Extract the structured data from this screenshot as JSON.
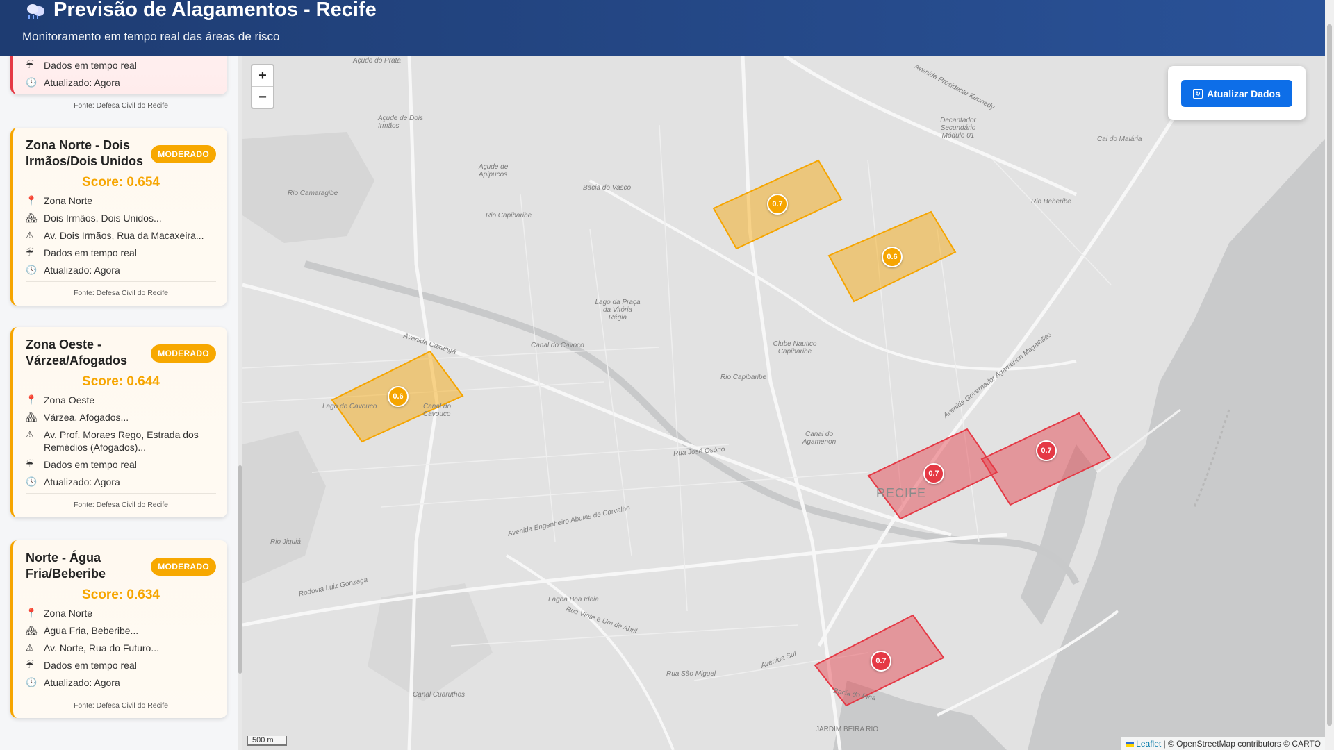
{
  "header": {
    "title": "Previsão de Alagamentos - Recife",
    "subtitle": "Monitoramento em tempo real das áreas de risco"
  },
  "sidebar": {
    "partial_card": {
      "rows": [
        "Dados em tempo real",
        "Atualizado: Agora"
      ],
      "source": "Fonte: Defesa Civil do Recife"
    },
    "cards": [
      {
        "title": "Zona Norte - Dois Irmãos/Dois Unidos",
        "badge": "MODERADO",
        "score": "Score: 0.654",
        "zone": "Zona Norte",
        "neighborhoods": "Dois Irmãos, Dois Unidos...",
        "streets": "Av. Dois Irmãos, Rua da Macaxeira...",
        "data": "Dados em tempo real",
        "updated": "Atualizado: Agora",
        "source": "Fonte: Defesa Civil do Recife"
      },
      {
        "title": "Zona Oeste - Várzea/Afogados",
        "badge": "MODERADO",
        "score": "Score: 0.644",
        "zone": "Zona Oeste",
        "neighborhoods": "Várzea, Afogados...",
        "streets": "Av. Prof. Moraes Rego, Estrada dos Remédios (Afogados)...",
        "data": "Dados em tempo real",
        "updated": "Atualizado: Agora",
        "source": "Fonte: Defesa Civil do Recife"
      },
      {
        "title": "Norte - Água Fria/Beberibe",
        "badge": "MODERADO",
        "score": "Score: 0.634",
        "zone": "Zona Norte",
        "neighborhoods": "Água Fria, Beberibe...",
        "streets": "Av. Norte, Rua do Futuro...",
        "data": "Dados em tempo real",
        "updated": "Atualizado: Agora",
        "source": "Fonte: Defesa Civil do Recife"
      }
    ]
  },
  "map": {
    "zoom_in": "+",
    "zoom_out": "−",
    "refresh_button": "Atualizar Dados",
    "scale": "500 m",
    "attribution_leaflet": "Leaflet",
    "attribution_rest": "| © OpenStreetMap contributors © CARTO",
    "city_label": "RECIFE",
    "markers": [
      "0.7",
      "0.6",
      "0.6",
      "0.7",
      "0.7",
      "0.7"
    ],
    "labels": [
      "Açude do Prata",
      "Avenida Presidente Kennedy",
      "Decantador Secundário Módulo 01",
      "Cal do Malária",
      "Açude de Dois Irmãos",
      "Açude de Apipucos",
      "Rio Camaragibe",
      "Bacia do Vasco",
      "Rio Capibaribe",
      "Rio Beberibe",
      "Avenida Caxangá",
      "Lago da Praça da Vitória Régia",
      "Canal do Cavoco",
      "Clube Nautico Capibaribe",
      "Rio Capibaribe",
      "Lago do Cavouco",
      "Canal do Cavouco",
      "Avenida Governador Agamenon Magalhães",
      "Canal do Agamenon",
      "Rua José Osório",
      "Avenida Engenheiro Abdias de Carvalho",
      "Rio Jiquiá",
      "Rodovia Luiz Gonzaga",
      "Lagoa Boa Ideia",
      "Rua Vinte e Um de Abril",
      "Avenida Sul",
      "Rua São Miguel",
      "Canal Cuaruthos",
      "Bacia do Pina",
      "JARDIM BEIRA RIO"
    ]
  },
  "colors": {
    "header_start": "#1e3c72",
    "header_end": "#2a5298",
    "moderate": "#f6a500",
    "high": "#e53945",
    "button": "#0d6ee8"
  },
  "icons": [
    "cloud-rain-icon",
    "pin-icon",
    "map-icon",
    "warning-icon",
    "rain-icon",
    "clock-icon",
    "refresh-icon"
  ]
}
